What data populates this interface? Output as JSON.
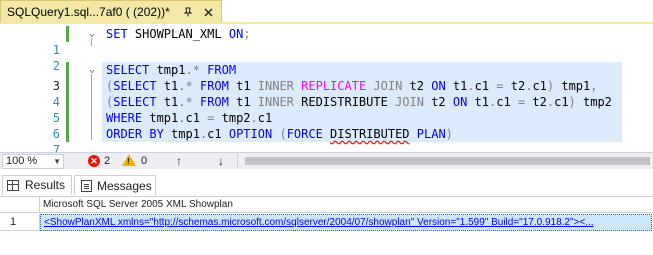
{
  "tab": {
    "title": "SQLQuery1.sql...7af0 ( (202))*",
    "pin_icon": "pin-icon",
    "close_icon": "close-icon"
  },
  "editor": {
    "line_numbers": [
      "1",
      "2",
      "3",
      "4",
      "5",
      "6",
      "7"
    ],
    "active_line": "3",
    "lines": {
      "l1": {
        "kw1": "SET",
        "t1": " SHOWPLAN_XML ",
        "kw2": "ON",
        "g1": ";"
      },
      "l3": {
        "kw1": "SELECT",
        "t1": " tmp1",
        "g1": ".*",
        "t2": " ",
        "kw2": "FROM"
      },
      "l4": {
        "g1": "(",
        "kw1": "SELECT",
        "t1": " t1",
        "g2": ".*",
        "t2": " ",
        "kw2": "FROM",
        "t3": " t1 ",
        "g3": "INNER",
        "t4": " ",
        "p1": "REPLICATE",
        "t5": " ",
        "g4": "JOIN",
        "t6": " t2 ",
        "kw3": "ON",
        "t7": " t1",
        "g5": ".",
        "t8": "c1 ",
        "g6": "=",
        "t9": " t2",
        "g7": ".",
        "t10": "c1",
        "g8": ")",
        "t11": " tmp1",
        "g9": ","
      },
      "l5": {
        "g1": "(",
        "kw1": "SELECT",
        "t1": " t1",
        "g2": ".*",
        "t2": " ",
        "kw2": "FROM",
        "t3": " t1 ",
        "g3": "INNER",
        "t4": " REDISTRIBUTE ",
        "g4": "JOIN",
        "t6": " t2 ",
        "kw3": "ON",
        "t7": " t1",
        "g5": ".",
        "t8": "c1 ",
        "g6": "=",
        "t9": " t2",
        "g7": ".",
        "t10": "c1",
        "g8": ")",
        "t11": " tmp2"
      },
      "l6": {
        "kw1": "WHERE",
        "t1": " tmp1",
        "g1": ".",
        "t2": "c1 ",
        "g2": "=",
        "t3": " tmp2",
        "g3": ".",
        "t4": "c1"
      },
      "l7": {
        "kw1": "ORDER",
        "t1": " ",
        "kw2": "BY",
        "t2": " tmp1",
        "g1": ".",
        "t3": "c1 ",
        "kw3": "OPTION",
        "t4": " ",
        "g2": "(",
        "kw4": "FORCE",
        "t5": " ",
        "sq": "DISTRIBUTED",
        "t6": " ",
        "kw5": "PLAN",
        "g3": ")"
      }
    }
  },
  "statusbar": {
    "zoom": "100 %",
    "errors": "2",
    "warnings": "0",
    "up_arrow": "↑",
    "down_arrow": "↓",
    "error_icon": "error-icon",
    "warning_icon": "warning-icon"
  },
  "results": {
    "tabs": [
      "Results",
      "Messages"
    ],
    "column_header": "Microsoft SQL Server 2005 XML Showplan",
    "rows": [
      {
        "num": "1",
        "value": "<ShowPlanXML xmlns=\"http://schemas.microsoft.com/sqlserver/2004/07/showplan\" Version=\"1.599\" Build=\"17.0.918.2\"><..."
      }
    ]
  },
  "colors": {
    "tab_bg": "#f3e8a6",
    "keyword": "#0000ff",
    "operator": "#808080",
    "pink_keyword": "#ff00ff",
    "line_number": "#2b91af",
    "selection": "#dcebfc",
    "cell_selected": "#cde6f7"
  }
}
